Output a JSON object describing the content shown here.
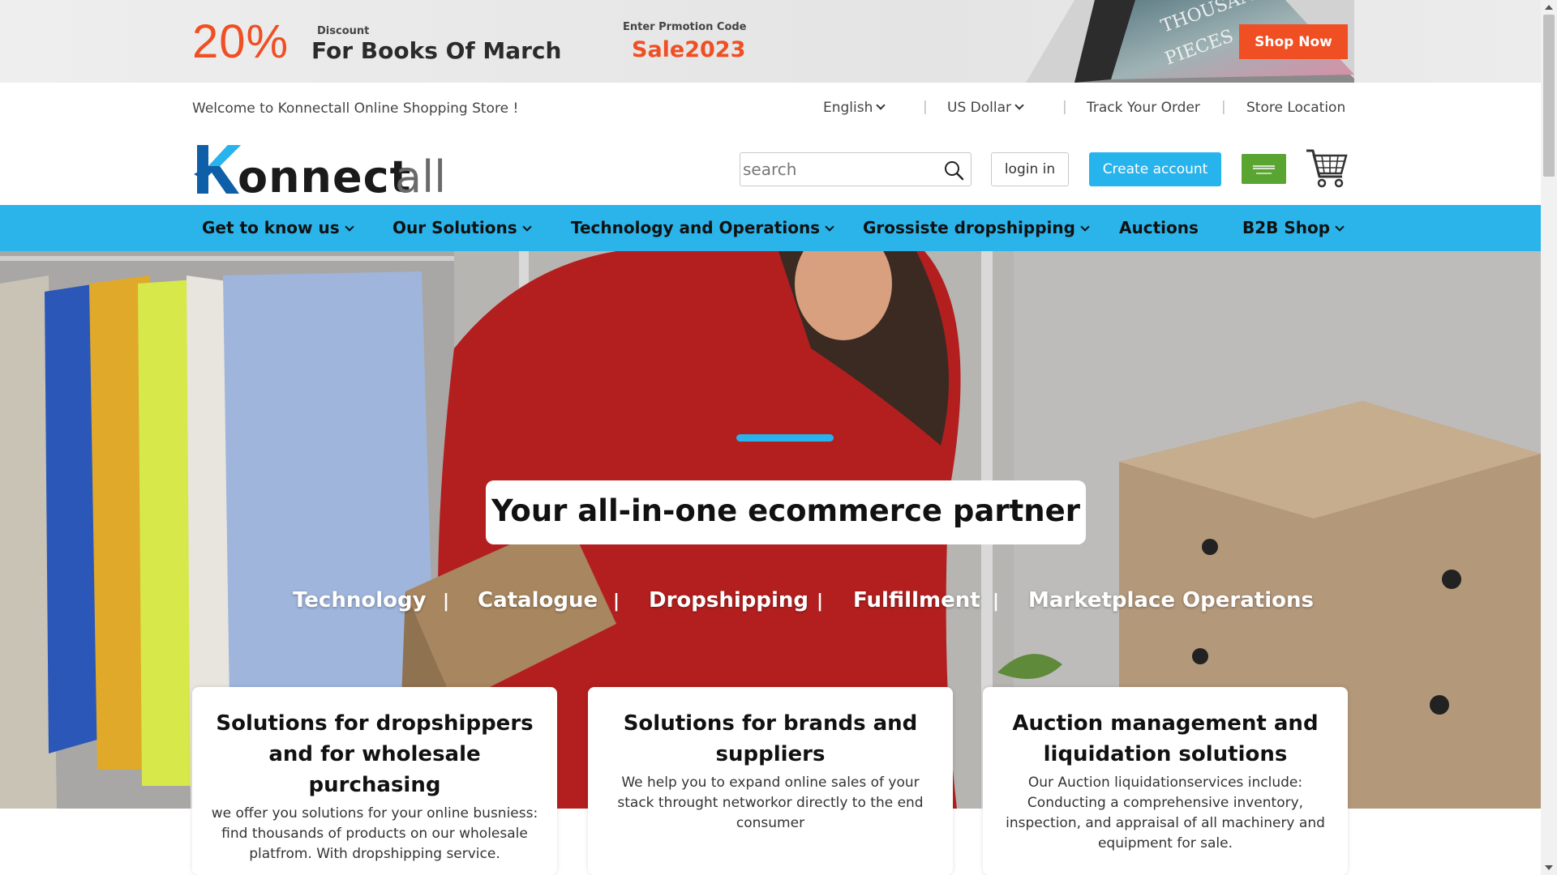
{
  "promo": {
    "percent": "20%",
    "discount_label": "Discount",
    "title": "For Books Of March",
    "code_label": "Enter Prmotion Code",
    "code": "Sale2023",
    "shop_now": "Shop Now",
    "accent_color": "#f04e23"
  },
  "topbar": {
    "welcome": "Welcome to Konnectall Online Shopping Store !",
    "language": "English",
    "currency": "US Dollar",
    "track_order": "Track Your Order",
    "store_location": "Store Location",
    "separator": "|"
  },
  "header": {
    "logo_text": "Konnectall",
    "search_placeholder": "search",
    "login": "login in",
    "create_account": "Create account",
    "flag_icon": "saudi-flag-icon",
    "cart_icon": "cart-icon",
    "button_color": "#27b3ec"
  },
  "nav": {
    "background": "#2ab4ea",
    "items": [
      {
        "label": "Get to know us",
        "dropdown": true
      },
      {
        "label": "Our Solutions",
        "dropdown": true
      },
      {
        "label": "Technology and Operations",
        "dropdown": true
      },
      {
        "label": "Grossiste dropshipping",
        "dropdown": true
      },
      {
        "label": "Auctions",
        "dropdown": false
      },
      {
        "label": "B2B Shop",
        "dropdown": true
      }
    ]
  },
  "hero": {
    "headline": "Your all-in-one ecommerce partner",
    "tags": [
      "Technology",
      "Catalogue",
      "Dropshipping",
      "Fulfillment",
      "Marketplace Operations"
    ],
    "tag_separator": "|"
  },
  "cards": [
    {
      "title": "Solutions for dropshippers and for wholesale purchasing",
      "text": "we offer you solutions for your online busniess: find thousands of products on our wholesale platfrom. With dropshipping service."
    },
    {
      "title": "Solutions for brands and suppliers",
      "text": "We help you to expand online sales of your stack throught networkor directly to the end consumer"
    },
    {
      "title": "Auction management and liquidation solutions",
      "text": "Our Auction liquidationservices include: Conducting a comprehensive inventory, inspection, and appraisal of all machinery and equipment for sale."
    }
  ]
}
